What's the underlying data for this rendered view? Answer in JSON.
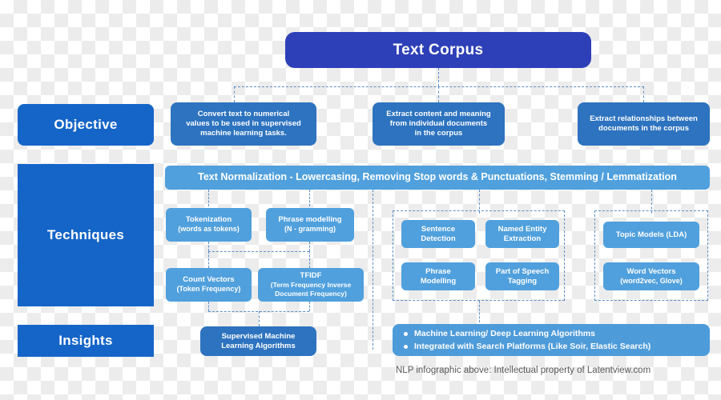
{
  "diagram": {
    "title": "NLP Infographic",
    "colors": {
      "navy": "#2e40b8",
      "dark_blue": "#1565c8",
      "mid_blue": "#2d73bf",
      "light_blue": "#50a0dd",
      "bullet_blue": "#4e9bd9",
      "dashed_line": "#5b8fc9",
      "footer_text": "#585858"
    }
  },
  "top": {
    "text_corpus": "Text Corpus"
  },
  "rows": {
    "objective_label": "Objective",
    "techniques_label": "Techniques",
    "insights_label": "Insights"
  },
  "objective": {
    "items": [
      {
        "text": "Convert text to numerical\nvalues to be used in supervised\nmachine learning tasks."
      },
      {
        "text": "Extract content and meaning\nfrom individual documents\nin the corpus"
      },
      {
        "text": "Extract relationships between\ndocuments in the corpus"
      }
    ]
  },
  "normalization": {
    "text": "Text Normalization - Lowercasing, Removing Stop words & Punctuations, Stemming / Lemmatization"
  },
  "techniques": {
    "group_left": [
      {
        "title": "Tokenization",
        "sub": "(words as tokens)"
      },
      {
        "title": "Phrase modelling",
        "sub": "(N - gramming)"
      },
      {
        "title": "Count Vectors",
        "sub": "(Token Frequency)"
      },
      {
        "title": "TFIDF",
        "sub": "(Term Frequency Inverse\nDocument Frequency)"
      }
    ],
    "group_middle": [
      {
        "title": "Sentence\nDetection",
        "sub": ""
      },
      {
        "title": "Named Entity\nExtraction",
        "sub": ""
      },
      {
        "title": "Phrase\nModelling",
        "sub": ""
      },
      {
        "title": "Part of Speech\nTagging",
        "sub": ""
      }
    ],
    "group_right": [
      {
        "title": "Topic Models (LDA)",
        "sub": ""
      },
      {
        "title": "Word Vectors",
        "sub": "(word2vec, Glove)"
      }
    ]
  },
  "insights": {
    "supervised_box": {
      "title": "Supervised Machine",
      "sub": "Learning Algorithms"
    },
    "bullets": [
      "Machine Learning/ Deep Learning Algorithms",
      "Integrated with Search Platforms (Like Soir, Elastic Search)"
    ]
  },
  "footer": {
    "text": "NLP infographic above: Intellectual property of Latentview.com"
  }
}
